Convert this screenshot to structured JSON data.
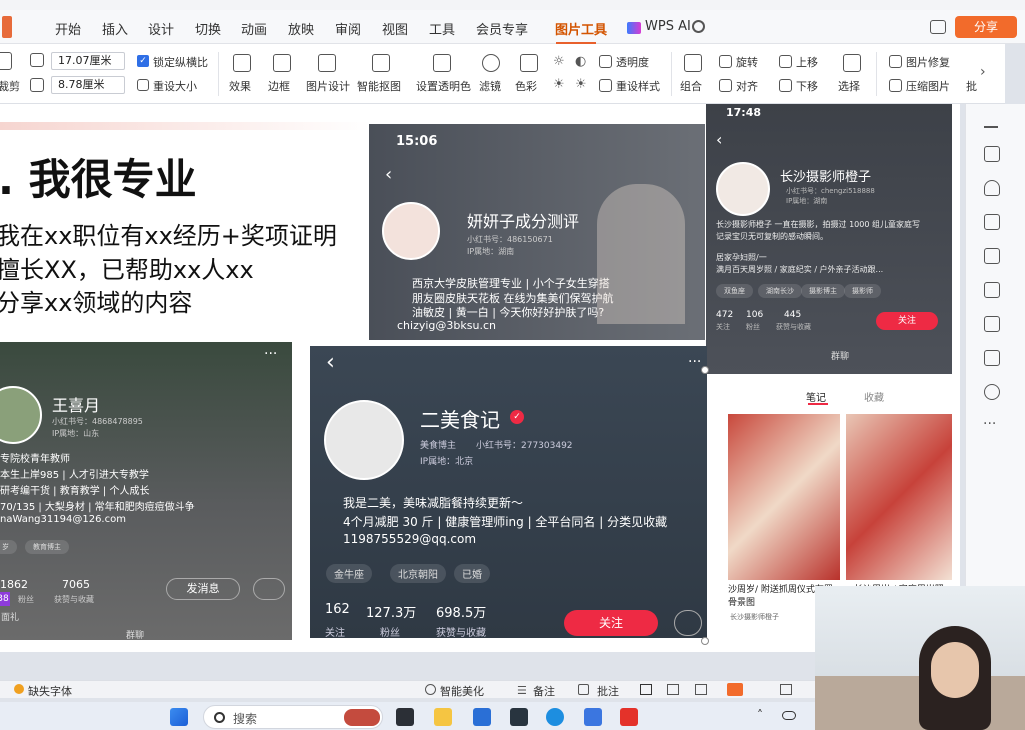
{
  "menubar": {
    "tabs": [
      "开始",
      "插入",
      "设计",
      "切换",
      "动画",
      "放映",
      "审阅",
      "视图",
      "工具",
      "会员专享",
      "图片工具",
      "WPS AI"
    ],
    "active_tab": "图片工具",
    "share_label": "分享"
  },
  "ribbon": {
    "crop_label": "裁剪",
    "width_value": "17.07厘米",
    "height_value": "8.78厘米",
    "lock_ratio_label": "锁定纵横比",
    "reset_size_label": "重设大小",
    "effects_label": "效果",
    "border_label": "边框",
    "picture_design_label": "图片设计",
    "smart_cutout_label": "智能抠图",
    "set_transparent_label": "设置透明色",
    "filter_label": "滤镜",
    "color_label": "色彩",
    "transparency_label": "透明度",
    "reset_style_label": "重设样式",
    "combine_label": "组合",
    "rotate_label": "旋转",
    "align_label": "对齐",
    "move_up_label": "上移",
    "move_down_label": "下移",
    "select_label": "选择",
    "repair_label": "图片修复",
    "compress_label": "压缩图片",
    "batch_label": "批"
  },
  "slide": {
    "heading": ". 我很专业",
    "lines": [
      "我在xx职位有xx经历+奖项证明",
      "擅长XX，已帮助xx人xx",
      "分享xx领域的内容"
    ]
  },
  "profile1": {
    "time": "15:06",
    "name": "妍妍子成分测评",
    "xhs_id": "小红书号：486150671",
    "ip": "IP属地：湖南",
    "bio": [
      "西京大学皮肤管理专业 | 小个子女生穿搭",
      "朋友圈皮肤天花板 在线为集美们保驾护航",
      "油敏皮 | 黄一白 | 今天你好好护肤了吗?",
      "chizyig@3bksu.cn"
    ]
  },
  "profile2": {
    "time": "17:48",
    "name": "长沙摄影师橙子",
    "xhs_id": "小红书号：chengzi518888",
    "ip": "IP属地：湖南",
    "bio": [
      "长沙摄影师橙子 一直在摄影，拍摄过 1000 组儿童家庭写",
      "记录宝贝无可复制的感动瞬间。",
      "居家孕妇照/一",
      "满月百天周岁照 / 家庭纪实 / 户外亲子活动跟..."
    ],
    "tags": [
      "双鱼座",
      "湖南长沙",
      "摄影博主",
      "摄影师"
    ],
    "follows": "472",
    "follows_label": "关注",
    "fans": "106",
    "fans_label": "粉丝",
    "likes": "445",
    "likes_label": "获赞与收藏",
    "follow_btn": "关注",
    "group_chat": "群聊",
    "tab_notes": "笔记",
    "tab_collect": "收藏",
    "post1_title": "沙周岁/ 附送抓周仪式布置",
    "post1_sub": "骨景图",
    "post1_author": "长沙摄影师橙子",
    "post2_title": "长沙周岁 / 家庭周岁照"
  },
  "profile3": {
    "name": "王喜月",
    "xhs_id": "小红书号：4868478895",
    "ip": "IP属地：山东",
    "bio": [
      "专院校青年教师",
      "本生上岸985 | 人才引进大专教学",
      "研考编干货 | 教育教学 | 个人成长",
      "70/135 | 大梨身材 | 常年和肥肉痘痘做斗争",
      "naWang31194@126.com"
    ],
    "tags": [
      "岁",
      "教育博主"
    ],
    "stat1": "1862",
    "stat2": "7065",
    "stat2_label": "获赞与收藏",
    "stat1_label": "粉丝",
    "stat0": "38",
    "message_btn": "发消息",
    "group_chat": "群聊",
    "snippet": "面礼"
  },
  "profile4": {
    "name": "二美食记",
    "role": "美食博主",
    "xhs_id": "小红书号：277303492",
    "ip": "IP属地：北京",
    "bio": [
      "我是二美，美味减脂餐持续更新～",
      "4个月减肥 30 斤 | 健康管理师ing | 全平台同名 | 分类见收藏",
      "1198755529@qq.com"
    ],
    "tags": [
      "金牛座",
      "北京朝阳",
      "已婚"
    ],
    "follows": "162",
    "follows_label": "关注",
    "fans": "127.3万",
    "fans_label": "粉丝",
    "likes": "698.5万",
    "likes_label": "获赞与收藏",
    "follow_btn": "关注"
  },
  "statusbar": {
    "missing_font": "缺失字体",
    "smart_beautify": "智能美化",
    "notes": "备注",
    "comments": "批注"
  },
  "taskbar": {
    "search_placeholder": "搜索"
  },
  "colors": {
    "accent": "#f26b2b",
    "brand_red": "#ee2a44",
    "dark_card": "#2c3138"
  }
}
